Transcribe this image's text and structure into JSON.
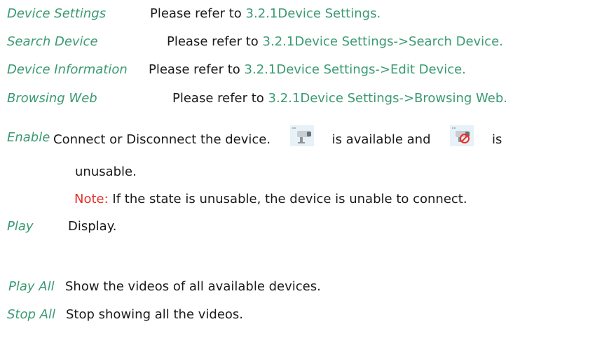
{
  "items": [
    {
      "term": "Device Settings",
      "prefix": "Please refer to ",
      "ref": "3.2.1Device Settings."
    },
    {
      "term": "Search Device",
      "prefix": "Please refer to ",
      "ref": "3.2.1Device Settings->Search Device."
    },
    {
      "term": "Device Information",
      "prefix": "Please refer to ",
      "ref": "3.2.1Device Settings->Edit Device."
    },
    {
      "term": "Browsing Web",
      "prefix": "Please refer to ",
      "ref": "3.2.1Device Settings->Browsing Web."
    }
  ],
  "enable": {
    "term": "Enable",
    "text_before": "Connect or Disconnect the device.",
    "available_icon": "camera-available-icon",
    "text_middle": "is available and",
    "unusable_icon": "camera-unusable-icon",
    "text_after": "is",
    "continuation": "unusable.",
    "note_label": "Note:",
    "note_text": " If the state is unusable, the device is unable to connect."
  },
  "play": {
    "term": "Play",
    "desc": "Display."
  },
  "play_all": {
    "term": "Play All",
    "desc": "Show the videos of all available devices."
  },
  "stop_all": {
    "term": "Stop All",
    "desc": "Stop showing all the videos."
  },
  "colors": {
    "term": "#3a9a72",
    "note": "#e8302a",
    "text": "#1a1a1a"
  }
}
